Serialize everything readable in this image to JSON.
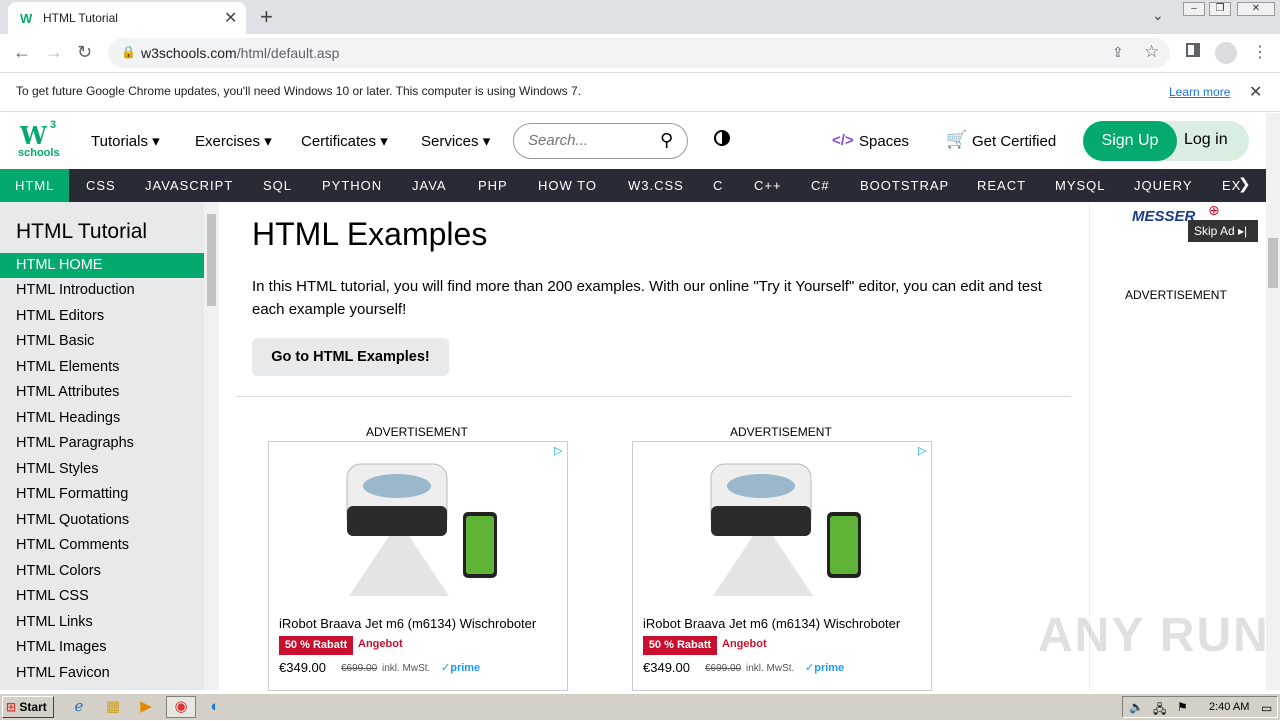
{
  "browser": {
    "tab_title": "HTML Tutorial",
    "url_domain": "w3schools.com",
    "url_path": "/html/default.asp",
    "infobar_text": "To get future Google Chrome updates, you'll need Windows 10 or later. This computer is using Windows 7.",
    "infobar_link": "Learn more"
  },
  "header": {
    "logo_sup": "3",
    "logo_main": "W",
    "logo_sub": "schools",
    "menu": [
      "Tutorials",
      "Exercises",
      "Certificates",
      "Services"
    ],
    "search_placeholder": "Search...",
    "spaces_label": "Spaces",
    "certified_label": "Get Certified",
    "signup_label": "Sign Up",
    "login_label": "Log in"
  },
  "topnav": {
    "items": [
      "HTML",
      "CSS",
      "JAVASCRIPT",
      "SQL",
      "PYTHON",
      "JAVA",
      "PHP",
      "HOW TO",
      "W3.CSS",
      "C",
      "C++",
      "C#",
      "BOOTSTRAP",
      "REACT",
      "MYSQL",
      "JQUERY",
      "EX"
    ]
  },
  "sidebar": {
    "title": "HTML Tutorial",
    "items": [
      "HTML HOME",
      "HTML Introduction",
      "HTML Editors",
      "HTML Basic",
      "HTML Elements",
      "HTML Attributes",
      "HTML Headings",
      "HTML Paragraphs",
      "HTML Styles",
      "HTML Formatting",
      "HTML Quotations",
      "HTML Comments",
      "HTML Colors",
      "HTML CSS",
      "HTML Links",
      "HTML Images",
      "HTML Favicon"
    ]
  },
  "main": {
    "heading": "HTML Examples",
    "paragraph": "In this HTML tutorial, you will find more than 200 examples. With our online \"Try it Yourself\" editor, you can edit and test each example yourself!",
    "button_label": "Go to HTML Examples!",
    "ads": [
      {
        "label": "ADVERTISEMENT",
        "title": "iRobot Braava Jet m6 (m6134) Wischroboter",
        "badge": "50 % Rabatt",
        "angebot": "Angebot",
        "price": "€349.00",
        "old_price": "€699.00",
        "tax": "inkl. MwSt.",
        "prime": "prime"
      },
      {
        "label": "ADVERTISEMENT",
        "title": "iRobot Braava Jet m6 (m6134) Wischroboter",
        "badge": "50 % Rabatt",
        "angebot": "Angebot",
        "price": "€349.00",
        "old_price": "€699.00",
        "tax": "inkl. MwSt.",
        "prime": "prime"
      }
    ]
  },
  "right_column": {
    "brand": "MESSER",
    "skip_ad": "Skip Ad",
    "ad_label": "ADVERTISEMENT"
  },
  "watermark": "ANY RUN",
  "taskbar": {
    "start_label": "Start",
    "clock": "2:40 AM"
  },
  "colors": {
    "accent_green": "#04AA6D",
    "topnav_bg": "#282A35",
    "sidebar_bg": "#E7E9EB"
  }
}
